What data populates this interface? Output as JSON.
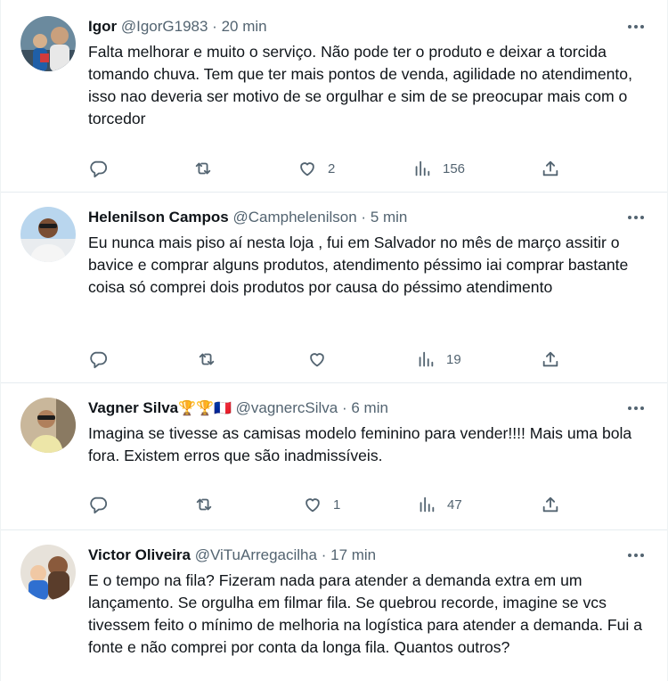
{
  "more_label": "•••",
  "tweets": [
    {
      "name": "Igor",
      "handle": "@IgorG1983",
      "dot": "·",
      "time": "20 min",
      "emoji": "",
      "text": "Falta melhorar e muito o serviço. Não pode ter o produto e deixar a torcida tomando chuva. Tem que ter mais pontos de venda, agilidade no atendimento, isso nao deveria ser motivo de se orgulhar e sim de se preocupar mais com o torcedor",
      "likes": "2",
      "views": "156"
    },
    {
      "name": "Helenilson Campos",
      "handle": "@Camphelenilson",
      "dot": "·",
      "time": "5 min",
      "emoji": "",
      "text": "Eu nunca mais piso aí nesta loja , fui em Salvador no mês de março  assitir o bavice e comprar alguns produtos, atendimento péssimo iai comprar bastante coisa só comprei dois produtos por causa do péssimo atendimento",
      "likes": "",
      "views": "19"
    },
    {
      "name": "Vagner Silva",
      "handle": "@vagnercSilva",
      "dot": "·",
      "time": "6 min",
      "emoji": "🏆🏆🇫🇷",
      "text": "Imagina se tivesse as camisas modelo feminino para vender!!!! Mais uma bola fora. Existem erros que são inadmissíveis.",
      "likes": "1",
      "views": "47"
    },
    {
      "name": "Victor Oliveira",
      "handle": "@ViTuArregacilha",
      "dot": "·",
      "time": "17 min",
      "emoji": "",
      "text": "E o tempo na fila? Fizeram nada para atender a demanda extra em um lançamento. Se orgulha em filmar fila. Se quebrou recorde, imagine se vcs tivessem feito o mínimo de melhoria na logística para atender a demanda. Fui a fonte e não comprei por conta da longa fila. Quantos outros?"
    }
  ],
  "icons": {
    "reply": "reply-icon",
    "retweet": "retweet-icon",
    "like": "like-icon",
    "views": "views-icon",
    "share": "share-icon",
    "more": "more-icon"
  },
  "colors": {
    "text": "#0f1419",
    "secondary": "#536471",
    "divider": "#e6ecf0"
  }
}
